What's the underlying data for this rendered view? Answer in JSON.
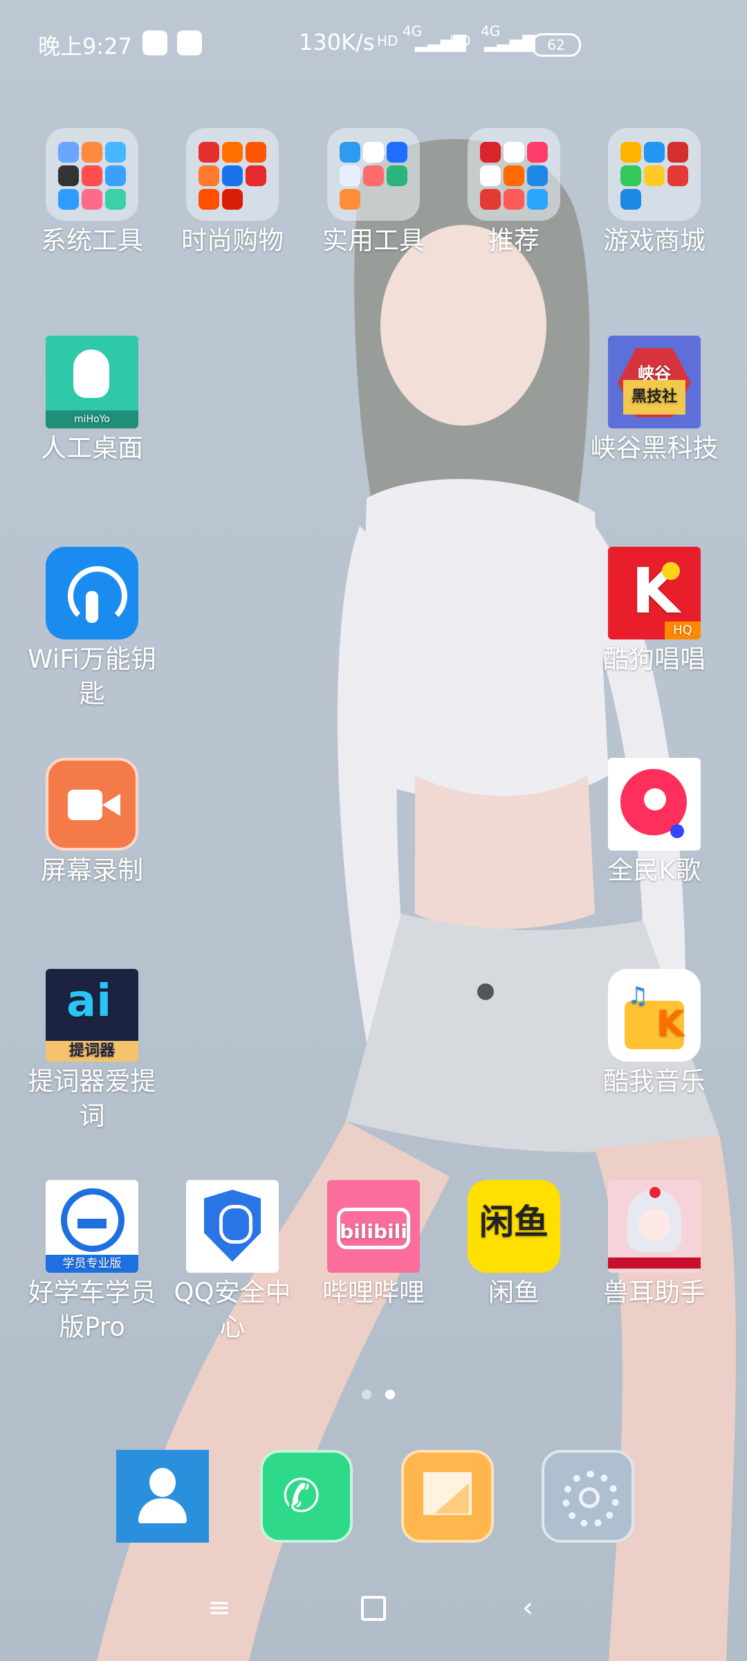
{
  "status_bar": {
    "time": "晚上9:27",
    "net_speed": "130K/s",
    "hd1": "HD",
    "net1": "4G",
    "hd2": "HD",
    "net2": "4G",
    "battery": "62"
  },
  "folders": [
    {
      "label": "系统工具"
    },
    {
      "label": "时尚购物"
    },
    {
      "label": "实用工具"
    },
    {
      "label": "推荐"
    },
    {
      "label": "游戏商城"
    }
  ],
  "apps": {
    "ren_gong_zhuo_mian": {
      "label": "人工桌面",
      "brand": "miHoYo"
    },
    "xia_gu": {
      "label": "峡谷黑科技",
      "badge1": "峡谷",
      "badge2": "黑技社"
    },
    "wifi": {
      "label": "WiFi万能钥匙"
    },
    "kugou_changchang": {
      "label": "酷狗唱唱",
      "tag": "HQ"
    },
    "screen_record": {
      "label": "屏幕录制"
    },
    "quanmin_k": {
      "label": "全民K歌"
    },
    "teleprompter": {
      "label": "提词器爱提词",
      "tag": "提词器"
    },
    "kuwo": {
      "label": "酷我音乐"
    },
    "haoxueche": {
      "label": "好学车学员版Pro",
      "tag": "学员专业版"
    },
    "qq_security": {
      "label": "QQ安全中心"
    },
    "bilibili": {
      "label": "哔哩哔哩",
      "logo": "bilibili"
    },
    "xianyu": {
      "label": "闲鱼",
      "logo": "闲鱼"
    },
    "shouer": {
      "label": "兽耳助手"
    }
  },
  "dock": [
    {
      "name": "contacts"
    },
    {
      "name": "phone"
    },
    {
      "name": "messages"
    },
    {
      "name": "settings"
    }
  ],
  "colors": {
    "miHoYo": "#2fc8a8",
    "xiagu": "#d7333e",
    "wifi": "#1a8cf0",
    "kugou": "#e81e2a",
    "record": "#f47a4a",
    "quanmin": "#ffffff",
    "tici": "#1b2340",
    "kuwo": "#ffffff",
    "haoxueche": "#ffffff",
    "qq": "#2a75e6",
    "bili": "#fb6d9b",
    "xianyu": "#ffe000",
    "shouer": "#f6d3d8",
    "dock_contacts": "#2a8fdc",
    "dock_phone": "#2ed98a",
    "dock_messages": "#ffb74d",
    "dock_settings": "#aebfd0"
  }
}
